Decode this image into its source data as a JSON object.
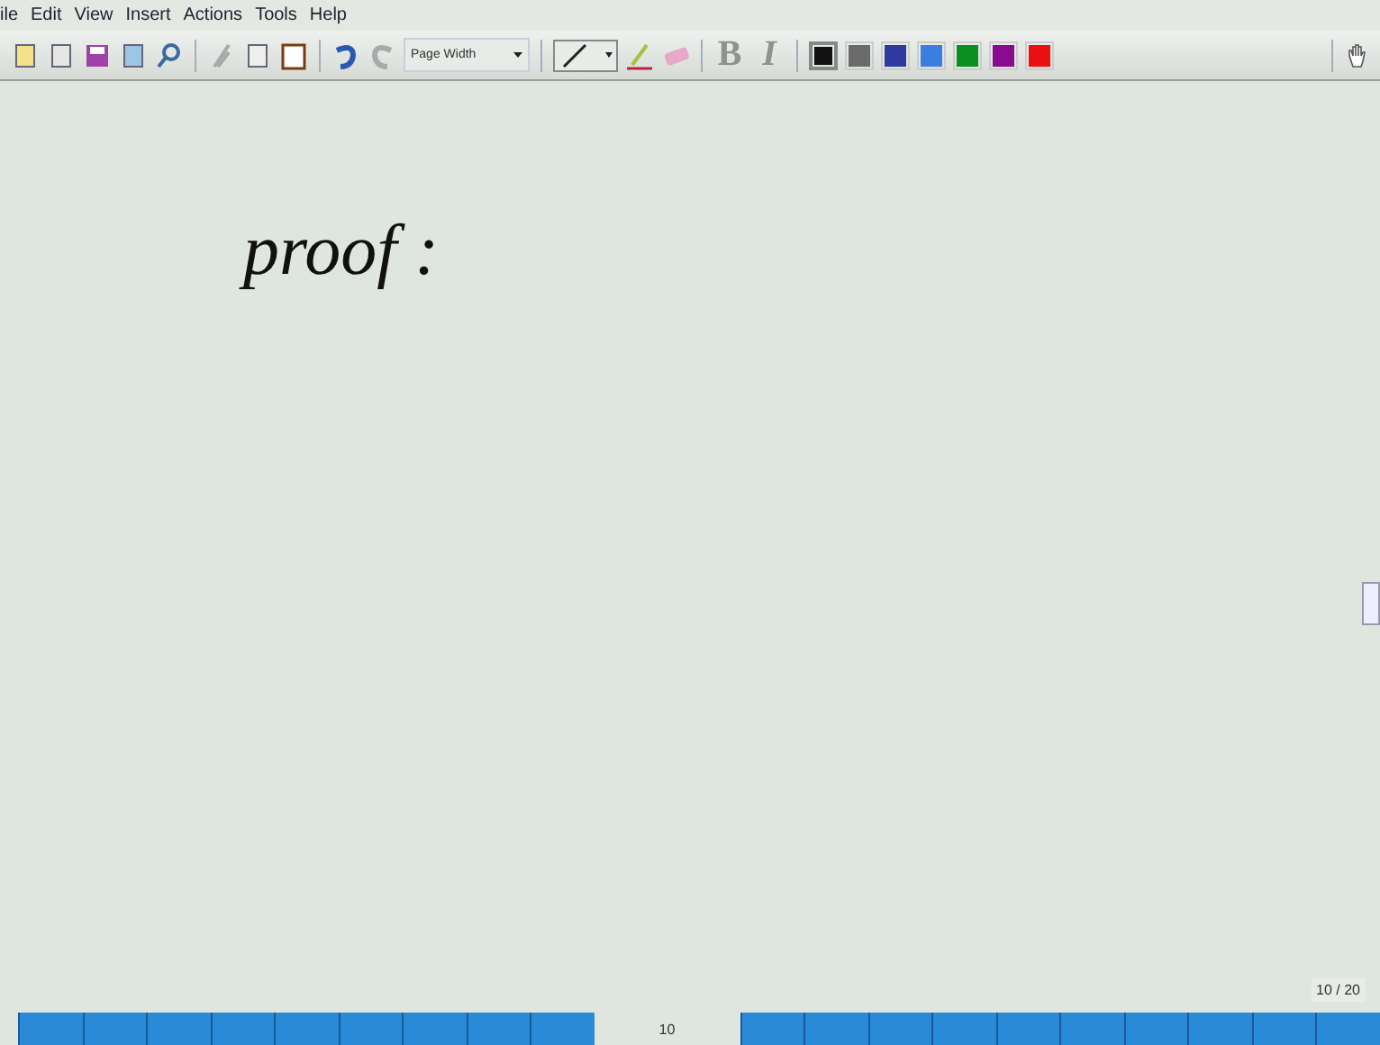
{
  "menu": [
    "ile",
    "Edit",
    "View",
    "Insert",
    "Actions",
    "Tools",
    "Help"
  ],
  "toolbar": {
    "zoom": "Page Width",
    "bold": "B",
    "italic": "I",
    "text_disabled": true,
    "colors": [
      {
        "color": "#111111",
        "selected": true
      },
      {
        "color": "#6b6b6b",
        "selected": false
      },
      {
        "color": "#2f3aa0",
        "selected": false
      },
      {
        "color": "#3a7fe0",
        "selected": false
      },
      {
        "color": "#0a9020",
        "selected": false
      },
      {
        "color": "#8a0a90",
        "selected": false
      },
      {
        "color": "#e81010",
        "selected": false
      }
    ]
  },
  "canvas": {
    "ink_text": "proof :"
  },
  "page_counter": "10 / 20",
  "page_strip": {
    "current": "10"
  }
}
